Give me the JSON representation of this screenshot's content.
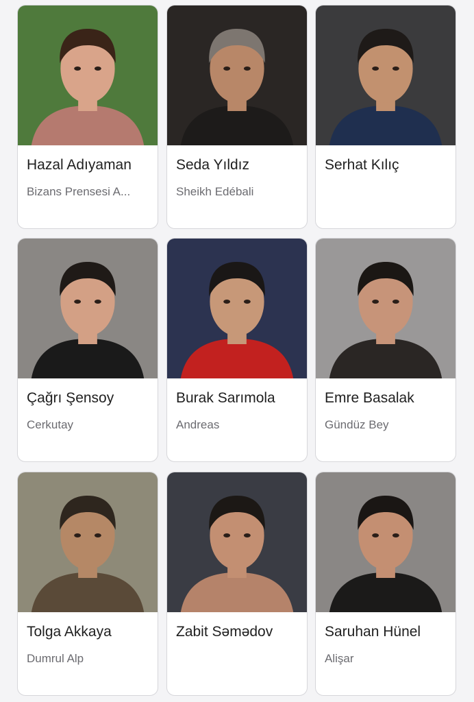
{
  "cast": [
    {
      "name": "Hazal Adıyaman",
      "role": "Bizans Prensesi A...",
      "photo_icon": "portrait-photo",
      "bg": "#4f7a3c",
      "shirt": "#b57a6f",
      "skin": "#d9a48a",
      "hair": "#3a2418"
    },
    {
      "name": "Seda Yıldız",
      "role": "Sheikh Edébali",
      "photo_icon": "portrait-photo",
      "bg": "#2a2624",
      "shirt": "#1d1b1a",
      "skin": "#b88768",
      "hair": "#7d7670"
    },
    {
      "name": "Serhat Kılıç",
      "role": "",
      "photo_icon": "portrait-photo",
      "bg": "#3b3b3d",
      "shirt": "#1f2f4f",
      "skin": "#c2916f",
      "hair": "#1e1a18"
    },
    {
      "name": "Çağrı Şensoy",
      "role": "Cerkutay",
      "photo_icon": "portrait-photo",
      "bg": "#8a8784",
      "shirt": "#1a1a1a",
      "skin": "#d3a085",
      "hair": "#1f1a17"
    },
    {
      "name": "Burak Sarımola",
      "role": "Andreas",
      "photo_icon": "portrait-photo",
      "bg": "#2c3350",
      "shirt": "#c2211f",
      "skin": "#c79878",
      "hair": "#1a1716"
    },
    {
      "name": "Emre Basalak",
      "role": "Gündüz Bey",
      "photo_icon": "portrait-photo",
      "bg": "#9a9898",
      "shirt": "#2a2624",
      "skin": "#c79479",
      "hair": "#1b1714"
    },
    {
      "name": "Tolga Akkaya",
      "role": "Dumrul Alp",
      "photo_icon": "portrait-photo",
      "bg": "#8e8a78",
      "shirt": "#5a4a38",
      "skin": "#b58866",
      "hair": "#2e261e"
    },
    {
      "name": "Zabit Səmədov",
      "role": "",
      "photo_icon": "portrait-photo",
      "bg": "#3a3c44",
      "shirt": "#b5836a",
      "skin": "#c38f72",
      "hair": "#1c1815"
    },
    {
      "name": "Saruhan Hünel",
      "role": "Alişar",
      "photo_icon": "portrait-photo",
      "bg": "#8a8785",
      "shirt": "#1b1a19",
      "skin": "#c48f72",
      "hair": "#1a1614"
    }
  ]
}
